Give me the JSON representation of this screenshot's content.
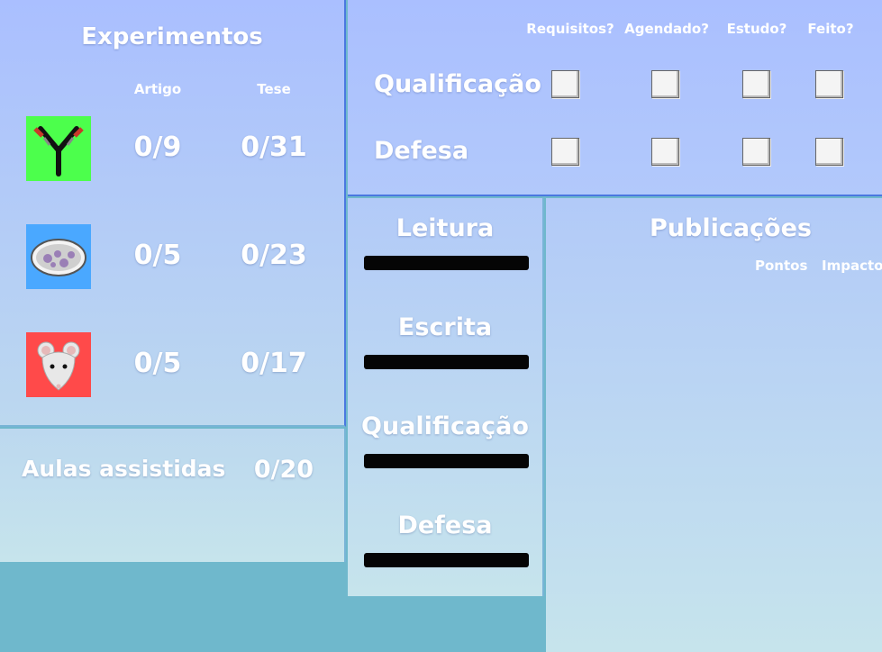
{
  "experiments": {
    "title": "Experimentos",
    "col_artigo": "Artigo",
    "col_tese": "Tese",
    "rows": [
      {
        "icon": "antibody-icon",
        "artigo": "0/9",
        "tese": "0/31",
        "color": "#4cff4c"
      },
      {
        "icon": "petri-dish-icon",
        "artigo": "0/5",
        "tese": "0/23",
        "color": "#4aa8ff"
      },
      {
        "icon": "mouse-icon",
        "artigo": "0/5",
        "tese": "0/17",
        "color": "#ff4a4a"
      }
    ]
  },
  "aulas": {
    "label": "Aulas assistidas",
    "value": "0/20"
  },
  "tasks": {
    "headers": [
      "Requisitos?",
      "Agendado?",
      "Estudo?",
      "Feito?"
    ],
    "rows": [
      {
        "label": "Qualificação",
        "checks": [
          false,
          false,
          false,
          false
        ]
      },
      {
        "label": "Defesa",
        "checks": [
          false,
          false,
          false,
          false
        ]
      }
    ]
  },
  "skills": [
    {
      "label": "Leitura",
      "progress": 0
    },
    {
      "label": "Escrita",
      "progress": 0
    },
    {
      "label": "Qualificação",
      "progress": 0
    },
    {
      "label": "Defesa",
      "progress": 0
    }
  ],
  "publications": {
    "title": "Publicações",
    "col_pontos": "Pontos",
    "col_impacto": "Impacto"
  }
}
